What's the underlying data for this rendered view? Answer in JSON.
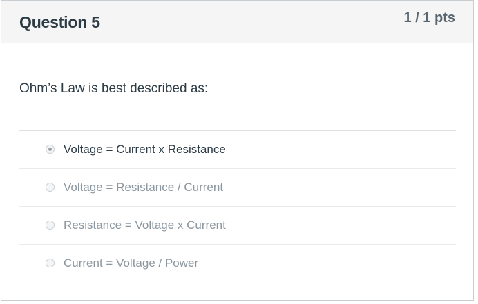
{
  "question": {
    "title": "Question 5",
    "points": "1 / 1 pts",
    "text": "Ohm’s Law is best described as:"
  },
  "answers": [
    {
      "label": "Voltage = Current x Resistance",
      "selected": true
    },
    {
      "label": "Voltage = Resistance / Current",
      "selected": false
    },
    {
      "label": "Resistance = Voltage x Current",
      "selected": false
    },
    {
      "label": "Current = Voltage / Power",
      "selected": false
    }
  ]
}
